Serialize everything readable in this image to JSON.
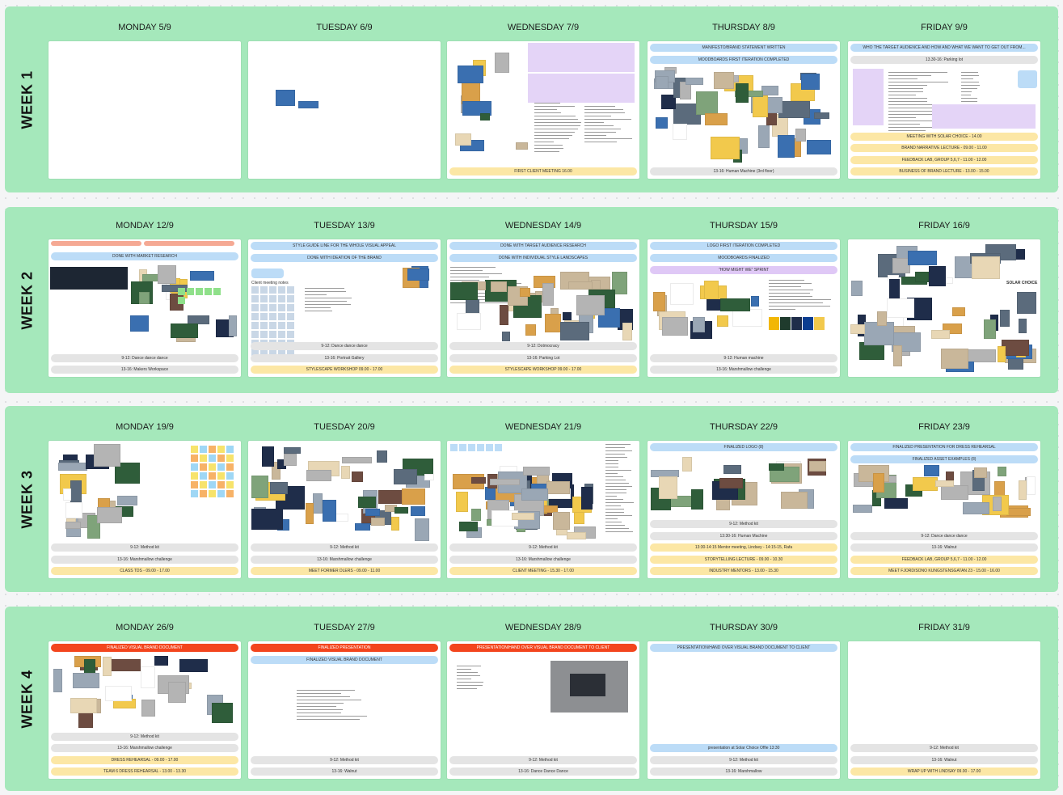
{
  "weeks": [
    {
      "label": "WEEK 1",
      "days": [
        {
          "title": "MONDAY 5/9",
          "bars_top": [],
          "bars_bottom": []
        },
        {
          "title": "TUESDAY 6/9",
          "bars_top": [],
          "bars_bottom": []
        },
        {
          "title": "WEDNESDAY 7/9",
          "bars_top": [],
          "bars_bottom": [
            {
              "text": "FIRST CLIENT MEETING 16.00",
              "color": "yellow"
            }
          ]
        },
        {
          "title": "THURSDAY 8/9",
          "bars_top": [
            {
              "text": "MANIFESTO/BRAND STATEMENT WRITTEN",
              "color": "blue"
            },
            {
              "text": "MOODBOARDS FIRST ITERATION COMPLETED",
              "color": "blue"
            }
          ],
          "bars_bottom": [
            {
              "text": "13-16: Human Machine (3rd floor)",
              "color": "gray"
            }
          ]
        },
        {
          "title": "FRIDAY 9/9",
          "bars_top": [
            {
              "text": "WHO THE TARGET AUDIENCE AND HOW AND WHAT WE WANT TO GET OUT FROM...",
              "color": "blue"
            },
            {
              "text": "13.30-16: Parking lot",
              "color": "gray"
            }
          ],
          "bars_bottom": [
            {
              "text": "MEETING WITH SOLAR CHOICE - 14.00",
              "color": "yellow"
            },
            {
              "text": "BRAND NARRATIVE LECTURE - 09.00 - 11.00",
              "color": "yellow"
            },
            {
              "text": "FEEDBACK LAB, GROUP 5,6,7 - 11.00 - 12.00",
              "color": "yellow"
            },
            {
              "text": "BUSINESS OF BRAND LECTURE - 13.00 - 15.00",
              "color": "yellow"
            }
          ]
        }
      ]
    },
    {
      "label": "WEEK 2",
      "days": [
        {
          "title": "MONDAY 12/9",
          "bars_top": [
            {
              "text": "DONE WITH MARKET RESEARCH",
              "color": "blue"
            }
          ],
          "bars_bottom": [
            {
              "text": "9-12: Dance dance dance",
              "color": "gray"
            },
            {
              "text": "13-16: Makers Workspace",
              "color": "gray"
            }
          ]
        },
        {
          "title": "TUESDAY 13/9",
          "bars_top": [
            {
              "text": "STYLE GUIDE LINE FOR THE WHOLE VISUAL APPEAL",
              "color": "blue"
            },
            {
              "text": "DONE WITH IDEATION OF THE BRAND",
              "color": "blue"
            }
          ],
          "bars_bottom": [
            {
              "text": "9-12: Dance dance dance",
              "color": "gray"
            },
            {
              "text": "13-16: Portrait Gallery",
              "color": "gray"
            },
            {
              "text": "STYLESCAPE WORKSHOP 09.00 - 17.00",
              "color": "yellow"
            }
          ],
          "note": "Client meeting notes"
        },
        {
          "title": "WEDNESDAY 14/9",
          "bars_top": [
            {
              "text": "DONE WITH TARGET AUDIENCE RESEARCH",
              "color": "blue"
            },
            {
              "text": "DONE WITH INDIVIDUAL STYLE LANDSCAPES",
              "color": "blue"
            }
          ],
          "bars_bottom": [
            {
              "text": "9-12: Dotmocracy",
              "color": "gray"
            },
            {
              "text": "13-16: Parking Lot",
              "color": "gray"
            },
            {
              "text": "STYLESCAPE WORKSHOP 09.00 - 17.00",
              "color": "yellow"
            }
          ]
        },
        {
          "title": "THURSDAY 15/9",
          "bars_top": [
            {
              "text": "LOGO FIRST ITERATION COMPLETED",
              "color": "blue"
            },
            {
              "text": "MOODBOARDS FINALIZED",
              "color": "blue"
            },
            {
              "text": "\"HOW MIGHT WE\" SPRINT",
              "color": "purple"
            }
          ],
          "bars_bottom": [
            {
              "text": "9-12: Human machine",
              "color": "gray"
            },
            {
              "text": "13-16: Marshmallow challenge",
              "color": "gray"
            }
          ]
        },
        {
          "title": "FRIDAY 16/9",
          "bars_top": [],
          "bars_bottom": [],
          "brand": "SOLAR CHOICE"
        }
      ]
    },
    {
      "label": "WEEK 3",
      "days": [
        {
          "title": "MONDAY 19/9",
          "bars_top": [],
          "bars_bottom": [
            {
              "text": "9-12: Method kit",
              "color": "gray"
            },
            {
              "text": "13-16: Marshmallow challenge",
              "color": "gray"
            },
            {
              "text": "CLASS TDS - 09.00 - 17.00",
              "color": "yellow"
            }
          ]
        },
        {
          "title": "TUESDAY 20/9",
          "bars_top": [],
          "bars_bottom": [
            {
              "text": "9-12: Method kit",
              "color": "gray"
            },
            {
              "text": "13-16: Marshmallow challenge",
              "color": "gray"
            },
            {
              "text": "MEET FORMER DLERS - 09.00 - 11.00",
              "color": "yellow"
            }
          ]
        },
        {
          "title": "WEDNESDAY 21/9",
          "bars_top": [],
          "bars_bottom": [
            {
              "text": "9-12: Method kit",
              "color": "gray"
            },
            {
              "text": "13-16: Marshmallow challenge",
              "color": "gray"
            },
            {
              "text": "CLIENT MEETING - 15.30 - 17.00",
              "color": "yellow"
            }
          ]
        },
        {
          "title": "THURSDAY 22/9",
          "bars_top": [
            {
              "text": "FINALIZED LOGO (8)",
              "color": "blue"
            }
          ],
          "bars_bottom": [
            {
              "text": "9-12: Method kit",
              "color": "gray"
            },
            {
              "text": "13:30-16: Human Machine",
              "color": "gray"
            },
            {
              "text": "13:30-14:15 Mentor meeting, Lindsey - 14:15-15, Rafa",
              "color": "yellow"
            },
            {
              "text": "STORYTELLING LECTURE - 09.00 - 10.30",
              "color": "yellow"
            },
            {
              "text": "INDUSTRY MENTORS - 13.00 - 15.30",
              "color": "yellow"
            }
          ]
        },
        {
          "title": "FRIDAY 23/9",
          "bars_top": [
            {
              "text": "FINALIZED PRESENTATION FOR DRESS REHEARSAL",
              "color": "blue"
            },
            {
              "text": "FINALIZED ASSET EXAMPLES (8)",
              "color": "blue"
            }
          ],
          "bars_bottom": [
            {
              "text": "9-12: Dance dance dance",
              "color": "gray"
            },
            {
              "text": "13-16: Walnut",
              "color": "gray"
            },
            {
              "text": "FEEDBACK LAB, GROUP 5,6,7 - 11.00 - 12.00",
              "color": "yellow"
            },
            {
              "text": "MEET FJORD/SONO KUNGSTENSGATAN 23 - 15.00 - 16.00",
              "color": "yellow"
            }
          ]
        }
      ]
    },
    {
      "label": "WEEK 4",
      "days": [
        {
          "title": "MONDAY 26/9",
          "bars_top": [
            {
              "text": "FINALIZED VISUAL BRAND DOCUMENT",
              "color": "red"
            }
          ],
          "bars_bottom": [
            {
              "text": "9-12: Method kit",
              "color": "gray"
            },
            {
              "text": "13-16: Marshmallow challenge",
              "color": "gray"
            },
            {
              "text": "DRESS REHEARSAL - 09.00 - 17.00",
              "color": "yellow"
            },
            {
              "text": "TEAM 6 DRESS REHEARSAL - 13.00 - 13.30",
              "color": "yellow"
            }
          ]
        },
        {
          "title": "TUESDAY 27/9",
          "bars_top": [
            {
              "text": "FINALIZED PRESENTATION",
              "color": "red"
            },
            {
              "text": "FINALIZED VISUAL BRAND DOCUMENT",
              "color": "blue"
            }
          ],
          "bars_bottom": [
            {
              "text": "9-12: Method kit",
              "color": "gray"
            },
            {
              "text": "13-16: Walnut",
              "color": "gray"
            }
          ]
        },
        {
          "title": "WEDNESDAY 28/9",
          "bars_top": [
            {
              "text": "PRESENTATION/HAND OVER VISUAL BRAND DOCUMENT TO CLIENT",
              "color": "red"
            }
          ],
          "bars_bottom": [
            {
              "text": "9-12: Method kit",
              "color": "gray"
            },
            {
              "text": "13-16: Dance Dance Dance",
              "color": "gray"
            }
          ]
        },
        {
          "title": "THURSDAY 30/9",
          "bars_top": [
            {
              "text": "PRESENTATION/HAND OVER VISUAL BRAND DOCUMENT TO CLIENT",
              "color": "blue"
            }
          ],
          "bars_bottom": [
            {
              "text": "presentation at Solar Choice Offie 13:30",
              "color": "blue"
            },
            {
              "text": "9-12: Method kit",
              "color": "gray"
            },
            {
              "text": "13-16: Marshmallow",
              "color": "gray"
            }
          ]
        },
        {
          "title": "FRIDAY 31/9",
          "bars_top": [],
          "bars_bottom": [
            {
              "text": "9-12: Method kit",
              "color": "gray"
            },
            {
              "text": "13-16: Walnut",
              "color": "gray"
            },
            {
              "text": "WRAP UP WITH LINDSAY 09.00 - 17.00",
              "color": "yellow"
            }
          ]
        }
      ]
    }
  ],
  "colors": {
    "week_bg": "#a5e8bb",
    "blue": "#bcdcf7",
    "gray": "#e4e4e4",
    "yellow": "#fce7a5",
    "red": "#f3451d",
    "purple": "#dfc8f6"
  }
}
